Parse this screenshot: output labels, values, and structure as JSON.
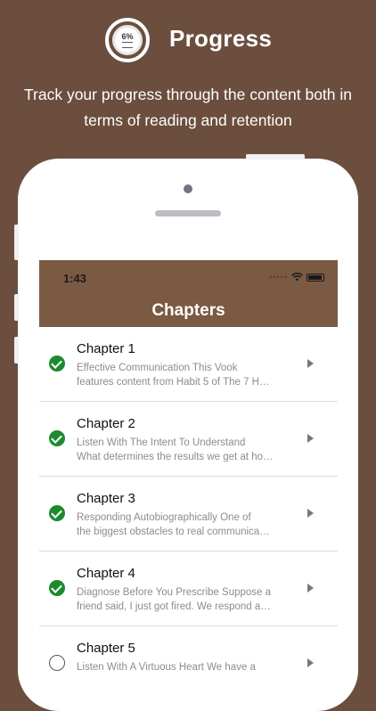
{
  "header": {
    "badge_percent": "6%",
    "title": "Progress",
    "subtitle": "Track your progress through the content both in terms of reading and retention"
  },
  "status_bar": {
    "time": "1:43",
    "signal_dots": "•••••"
  },
  "navbar": {
    "title": "Chapters"
  },
  "chapters": [
    {
      "title": "Chapter 1",
      "line1": "Effective Communication This Vook",
      "line2": "features content from Habit 5 of The 7 H…",
      "completed": true
    },
    {
      "title": "Chapter 2",
      "line1": " Listen With The Intent To Understand",
      "line2": "What determines the results we get at ho…",
      "completed": true
    },
    {
      "title": "Chapter 3",
      "line1": " Responding Autobiographically One of",
      "line2": "the biggest obstacles to real communica…",
      "completed": true
    },
    {
      "title": "Chapter 4",
      "line1": " Diagnose Before You Prescribe Suppose a",
      "line2": "friend said, I just got fired. We respond a…",
      "completed": true
    },
    {
      "title": "Chapter 5",
      "line1": " Listen With A Virtuous Heart We have a",
      "line2": "",
      "completed": false
    }
  ],
  "colors": {
    "background": "#6b4e3d",
    "navbar": "#7b5a43",
    "check": "#1e8a2e"
  }
}
